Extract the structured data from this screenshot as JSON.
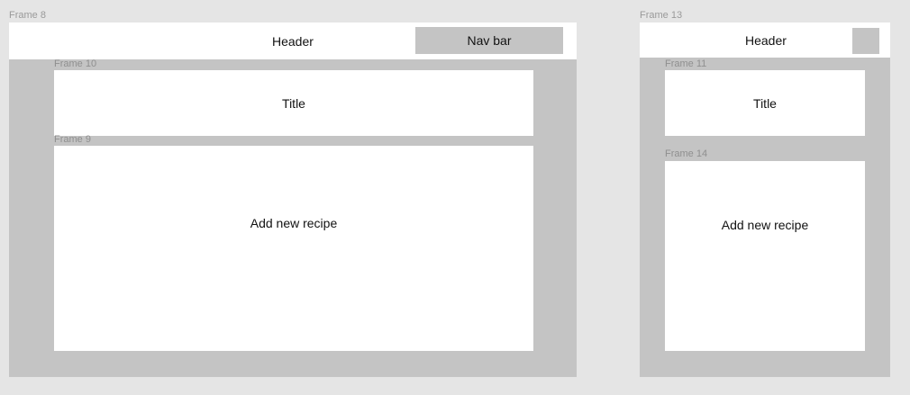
{
  "desktop": {
    "frame_label": "Frame 8",
    "header": {
      "label": "Header",
      "nav_label": "Nav bar"
    },
    "title_frame": {
      "frame_label": "Frame 10",
      "label": "Title"
    },
    "content_frame": {
      "frame_label": "Frame 9",
      "label": "Add new recipe"
    }
  },
  "mobile": {
    "frame_label": "Frame 13",
    "header": {
      "label": "Header"
    },
    "title_frame": {
      "frame_label": "Frame 11",
      "label": "Title"
    },
    "content_frame": {
      "frame_label": "Frame 14",
      "label": "Add new recipe"
    }
  },
  "colors": {
    "canvas": "#e5e5e5",
    "frame_fill": "#c4c4c4",
    "box_fill": "#ffffff",
    "label_text": "#9a9a9a"
  }
}
